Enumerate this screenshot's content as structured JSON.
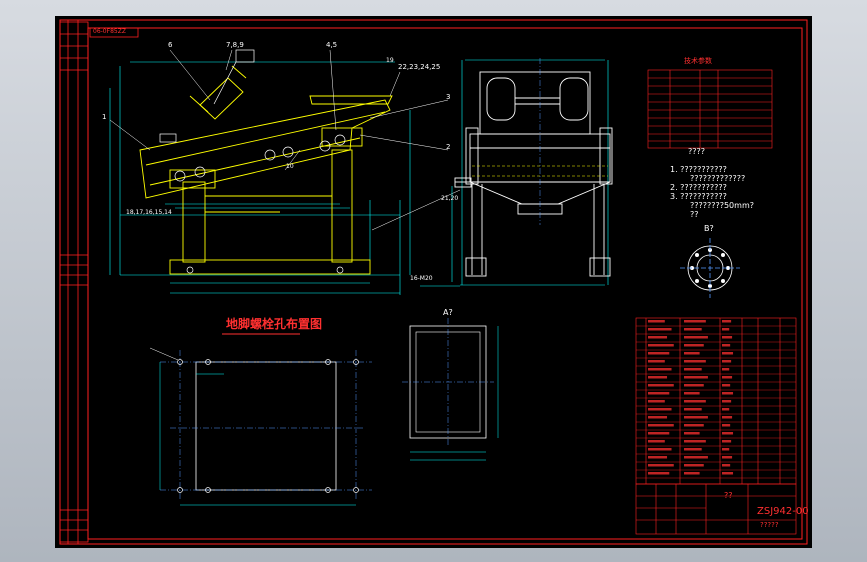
{
  "colors": {
    "background": "#000000",
    "frame": "#ff2020",
    "outline": "#ffffff",
    "dim": "#00ffff",
    "machine": "#ffff00",
    "center": "#5599ff",
    "text_yellow": "#ffff00",
    "text_red": "#ff3030",
    "text_white": "#ffffff"
  },
  "drawing": {
    "code_box": "06-0F85ZZ",
    "leader_labels": [
      "6",
      "7,8,9",
      "4,5",
      "3",
      "2",
      "1",
      "22,23,24,25",
      "18,17,16,15,14",
      "21,20",
      "10",
      "16-M20",
      "19"
    ],
    "note_lines": [
      "1. ???????????",
      "?????????????",
      "2. ???????????",
      "3. ???????????",
      "????????50mm?",
      "??"
    ],
    "section_b": "B?",
    "section_a": "A?",
    "bolt_plan_title": "地脚螺栓孔布置图",
    "tech_table_title": "技术参数",
    "drawing_number": "ZSJ942-00",
    "title_block_qmark": "??",
    "title_block_label": "?????",
    "fig_label": "????"
  }
}
